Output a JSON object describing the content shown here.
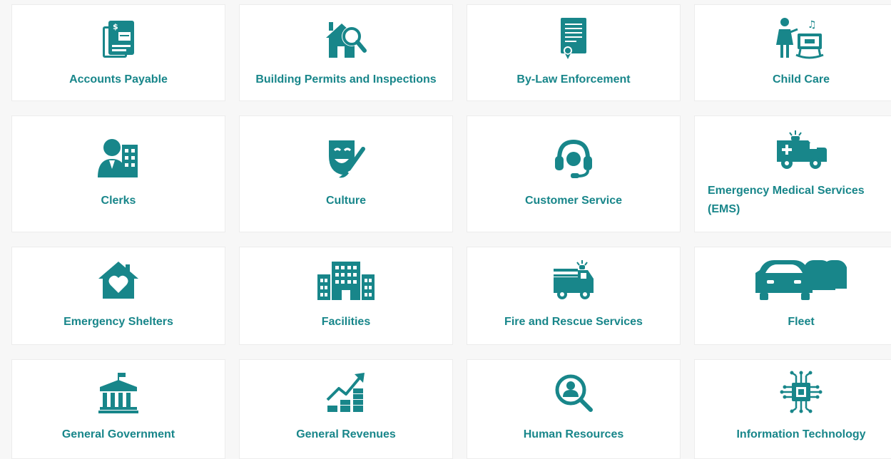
{
  "accent_color": "#18868a",
  "background_color": "#f7f7f7",
  "tiles": [
    {
      "label": "Accounts Payable",
      "icon": "invoice-icon"
    },
    {
      "label": "Building Permits and Inspections",
      "icon": "house-magnifier-icon"
    },
    {
      "label": "By-Law Enforcement",
      "icon": "certificate-document-icon"
    },
    {
      "label": "Child Care",
      "icon": "child-care-icon"
    },
    {
      "label": "Clerks",
      "icon": "clerk-person-icon"
    },
    {
      "label": "Culture",
      "icon": "theatre-mask-brush-icon"
    },
    {
      "label": "Customer Service",
      "icon": "headset-icon"
    },
    {
      "label": "Emergency Medical Services (EMS)",
      "icon": "ambulance-icon"
    },
    {
      "label": "Emergency Shelters",
      "icon": "house-heart-icon"
    },
    {
      "label": "Facilities",
      "icon": "buildings-icon"
    },
    {
      "label": "Fire and Rescue Services",
      "icon": "fire-truck-icon"
    },
    {
      "label": "Fleet",
      "icon": "cars-icon"
    },
    {
      "label": "General Government",
      "icon": "government-building-icon"
    },
    {
      "label": "General Revenues",
      "icon": "revenue-chart-icon"
    },
    {
      "label": "Human Resources",
      "icon": "person-search-icon"
    },
    {
      "label": "Information Technology",
      "icon": "circuit-chip-icon"
    }
  ]
}
